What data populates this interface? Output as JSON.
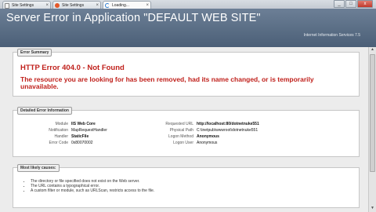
{
  "browser": {
    "tabs": [
      {
        "label": "Site Settings",
        "icon": "page-icon"
      },
      {
        "label": "Site Settings",
        "icon": "firefox-icon"
      },
      {
        "label": "Loading...",
        "icon": "loading-spinner-icon"
      }
    ],
    "window_buttons": [
      "_",
      "□",
      "x"
    ]
  },
  "header": {
    "title": "Server Error in Application \"DEFAULT WEB SITE\"",
    "subtitle": "Internet Information Services 7.5"
  },
  "summary": {
    "legend": "Error Summary",
    "code": "HTTP Error 404.0 - Not Found",
    "message": "The resource you are looking for has been removed, had its name changed, or is temporarily unavailable."
  },
  "details": {
    "legend": "Detailed Error Information",
    "left": [
      {
        "key": "Module",
        "value": "IIS Web Core"
      },
      {
        "key": "Notification",
        "value": "MapRequestHandler"
      },
      {
        "key": "Handler",
        "value": "StaticFile"
      },
      {
        "key": "Error Code",
        "value": "0x80070002"
      }
    ],
    "right": [
      {
        "key": "Requested URL",
        "value": "http://localhost:80/dotnetnuke551"
      },
      {
        "key": "Physical Path",
        "value": "C:\\inetpub\\wwwroot\\dotnetnuke551"
      },
      {
        "key": "Logon Method",
        "value": "Anonymous"
      },
      {
        "key": "Logon User",
        "value": "Anonymous"
      }
    ]
  },
  "causes": {
    "legend": "Most likely causes:",
    "items": [
      "The directory or file specified does not exist on the Web server.",
      "The URL contains a typographical error.",
      "A custom filter or module, such as URLScan, restricts access to the file."
    ]
  },
  "colors": {
    "header_bg": "#5a6d85",
    "error_red": "#c0211c"
  }
}
